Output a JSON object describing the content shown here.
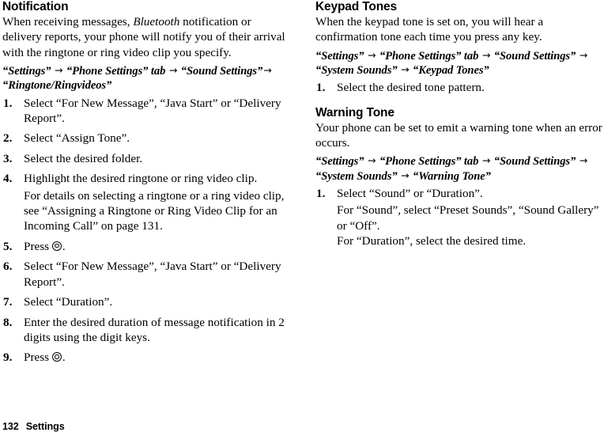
{
  "page": {
    "footer_page_number": "132",
    "footer_section": "Settings"
  },
  "left_column": {
    "sections": [
      {
        "heading": "Notification",
        "intro": {
          "before_italic": "When receiving messages, ",
          "italic": "Bluetooth",
          "after_italic": " notification or delivery reports, your phone will notify you of their arrival with the ringtone or ring video clip you specify."
        },
        "path": {
          "parts": [
            "“Settings”",
            "“Phone Settings” tab",
            "“Sound Settings”",
            "“Ringtone/Ringvideos”"
          ],
          "arrow": "→"
        },
        "steps": [
          {
            "num": "1.",
            "text": "Select “For New Message”, “Java Start” or “Delivery Report”."
          },
          {
            "num": "2.",
            "text": "Select “Assign Tone”."
          },
          {
            "num": "3.",
            "text": "Select the desired folder."
          },
          {
            "num": "4.",
            "text": "Highlight the desired ringtone or ring video clip.",
            "sub": "For details on selecting a ringtone or a ring video clip, see “Assigning a Ringtone or Ring Video Clip for an Incoming Call” on page 131."
          },
          {
            "num": "5.",
            "text_before_key": "Press ",
            "key_icon": "center-select-key-icon",
            "text_after_key": "."
          },
          {
            "num": "6.",
            "text": "Select “For New Message”, “Java Start” or “Delivery Report”."
          },
          {
            "num": "7.",
            "text": "Select “Duration”."
          },
          {
            "num": "8.",
            "text": "Enter the desired duration of message notification in 2 digits using the digit keys."
          },
          {
            "num": "9.",
            "text_before_key": "Press ",
            "key_icon": "center-select-key-icon",
            "text_after_key": "."
          }
        ]
      }
    ]
  },
  "right_column": {
    "sections": [
      {
        "heading": "Keypad Tones",
        "intro": "When the keypad tone is set on, you will hear a confirmation tone each time you press any key.",
        "path": {
          "parts": [
            "“Settings”",
            "“Phone Settings” tab",
            "“Sound Settings”",
            "“System Sounds”",
            "“Keypad Tones”"
          ],
          "arrow": "→"
        },
        "steps": [
          {
            "num": "1.",
            "text": "Select the desired tone pattern."
          }
        ]
      },
      {
        "heading": "Warning Tone",
        "intro": "Your phone can be set to emit a warning tone when an error occurs.",
        "path": {
          "parts": [
            "“Settings”",
            "“Phone Settings” tab",
            "“Sound Settings”",
            "“System Sounds”",
            "“Warning Tone”"
          ],
          "arrow": "→"
        },
        "steps": [
          {
            "num": "1.",
            "text": "Select “Sound” or “Duration”.",
            "sub": "For “Sound”, select “Preset Sounds”, “Sound Gallery” or “Off”.",
            "sub2": "For “Duration”, select the desired time."
          }
        ]
      }
    ]
  }
}
